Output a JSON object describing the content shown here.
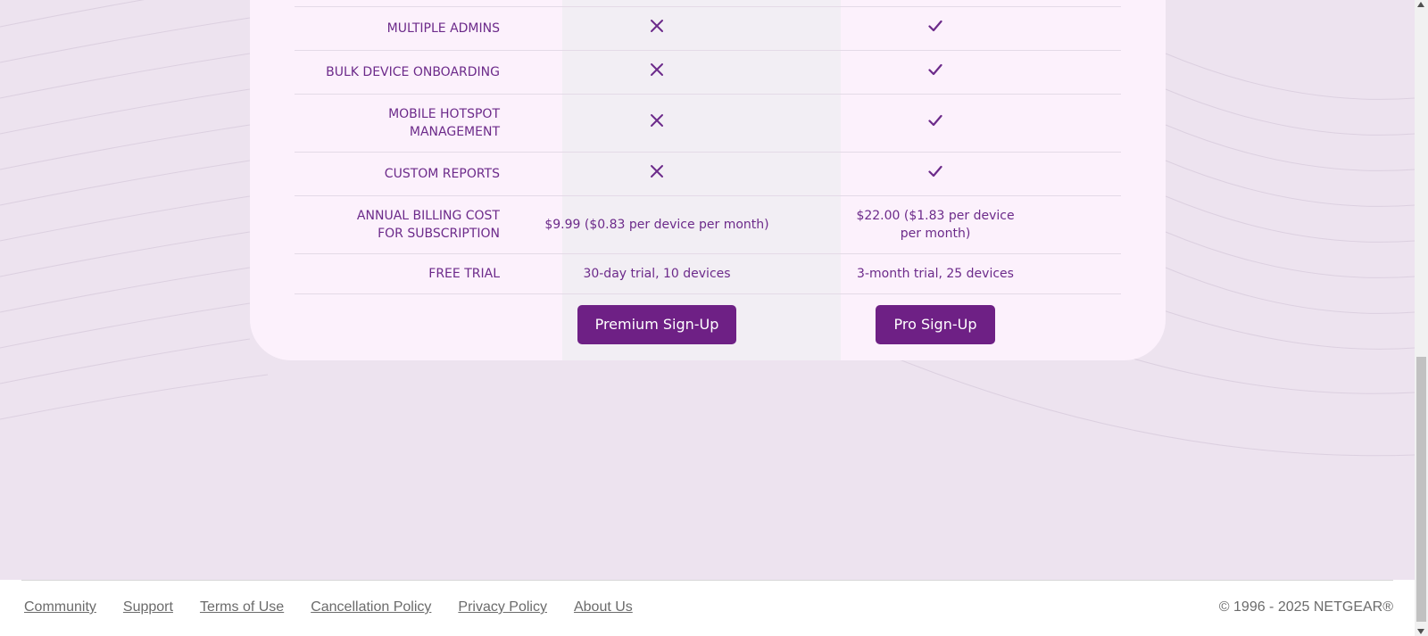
{
  "comparison": {
    "rows": [
      {
        "label": "MULTIPLE ADMINS",
        "premium": {
          "type": "icon",
          "icon": "x-icon"
        },
        "pro": {
          "type": "icon",
          "icon": "check-icon"
        }
      },
      {
        "label": "BULK DEVICE ONBOARDING",
        "premium": {
          "type": "icon",
          "icon": "x-icon"
        },
        "pro": {
          "type": "icon",
          "icon": "check-icon"
        }
      },
      {
        "label": "MOBILE HOTSPOT MANAGEMENT",
        "premium": {
          "type": "icon",
          "icon": "x-icon"
        },
        "pro": {
          "type": "icon",
          "icon": "check-icon"
        }
      },
      {
        "label": "CUSTOM REPORTS",
        "premium": {
          "type": "icon",
          "icon": "x-icon"
        },
        "pro": {
          "type": "icon",
          "icon": "check-icon"
        }
      },
      {
        "label": "ANNUAL BILLING COST FOR SUBSCRIPTION",
        "premium": {
          "type": "text",
          "text": "$9.99 ($0.83 per device per month)"
        },
        "pro": {
          "type": "text",
          "text": "$22.00 ($1.83 per device per month)"
        }
      },
      {
        "label": "FREE TRIAL",
        "premium": {
          "type": "text",
          "text": "30-day trial, 10 devices"
        },
        "pro": {
          "type": "text",
          "text": "3-month trial, 25 devices"
        }
      }
    ],
    "buttons": {
      "premium": "Premium Sign-Up",
      "pro": "Pro Sign-Up"
    }
  },
  "footer": {
    "links": [
      "Community",
      "Support",
      "Terms of Use",
      "Cancellation Policy",
      "Privacy Policy",
      "About Us"
    ],
    "copyright": "© 1996 - 2025 NETGEAR®"
  },
  "colors": {
    "accent": "#6e2085",
    "text": "#6c2a8a",
    "background": "#ede3ef",
    "card": "#fcf1fc"
  }
}
